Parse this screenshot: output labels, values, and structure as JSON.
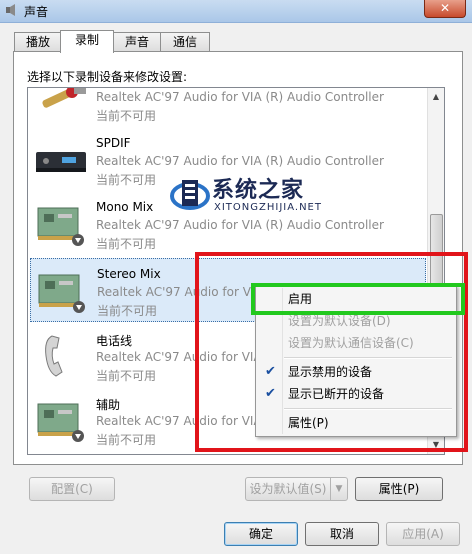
{
  "window": {
    "title": "声音",
    "close_glyph": "✕"
  },
  "tabs": [
    {
      "label": "播放",
      "active": false
    },
    {
      "label": "录制",
      "active": true
    },
    {
      "label": "声音",
      "active": false
    },
    {
      "label": "通信",
      "active": false
    }
  ],
  "instruction": "选择以下录制设备来修改设置:",
  "devices": [
    {
      "name": "",
      "desc": "Realtek AC'97 Audio for VIA (R) Audio Controller",
      "status": "当前不可用",
      "icon": "rca-connector-icon"
    },
    {
      "name": "SPDIF",
      "desc": "Realtek AC'97 Audio for VIA (R) Audio Controller",
      "status": "当前不可用",
      "icon": "spdif-device-icon"
    },
    {
      "name": "Mono Mix",
      "desc": "Realtek AC'97 Audio for VIA (R) Audio Controller",
      "status": "当前不可用",
      "icon": "sound-card-icon"
    },
    {
      "name": "Stereo Mix",
      "desc": "Realtek AC'97 Audio for VIA",
      "status": "当前不可用",
      "icon": "sound-card-icon"
    },
    {
      "name": "电话线",
      "desc": "Realtek AC'97 Audio for VIA",
      "status": "当前不可用",
      "icon": "telephone-handset-icon"
    },
    {
      "name": "辅助",
      "desc": "Realtek AC'97 Audio for VIA",
      "status": "当前不可用",
      "icon": "sound-card-icon"
    }
  ],
  "watermark": {
    "title": "系统之家",
    "sub": "XITONGZHIJIA.NET"
  },
  "context_menu": {
    "items": [
      {
        "label": "启用",
        "disabled": false,
        "checked": false
      },
      {
        "label": "设置为默认设备(D)",
        "disabled": true,
        "checked": false
      },
      {
        "label": "设置为默认通信设备(C)",
        "disabled": true,
        "checked": false
      },
      {
        "label": "显示禁用的设备",
        "disabled": false,
        "checked": true
      },
      {
        "label": "显示已断开的设备",
        "disabled": false,
        "checked": true
      },
      {
        "label": "属性(P)",
        "disabled": false,
        "checked": false
      }
    ],
    "check_glyph": "✔"
  },
  "buttons": {
    "configure": "配置(C)",
    "set_default": "设为默认值(S)",
    "set_default_arrow": "▼",
    "properties": "属性(P)",
    "ok": "确定",
    "cancel": "取消",
    "apply": "应用(A)"
  },
  "colors": {
    "highlight_red": "#e1141a",
    "highlight_green": "#22c91e",
    "selection": "#dbeaf9"
  }
}
